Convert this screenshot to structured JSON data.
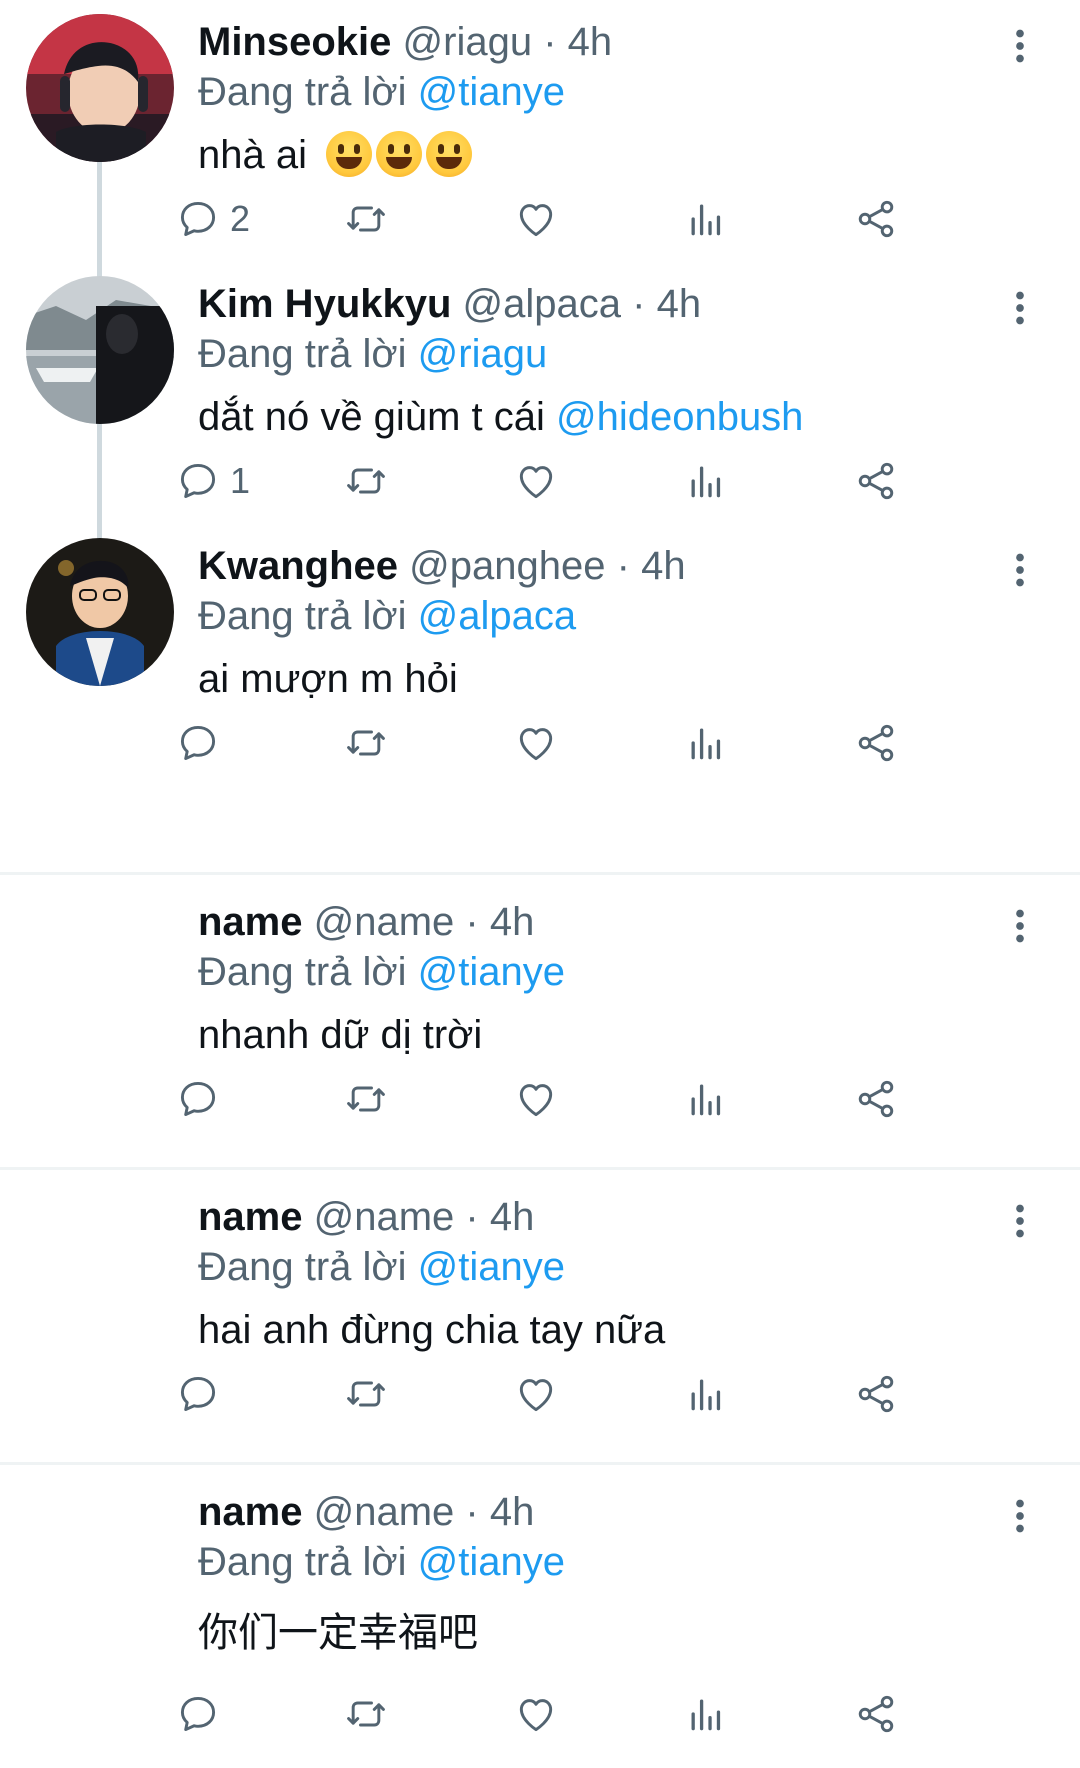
{
  "tweets": [
    {
      "name": "Minseokie",
      "handle": "@riagu",
      "time": "4h",
      "reply_prefix": "Đang trả lời",
      "reply_to": "@tianye",
      "text": "nhà ai",
      "emoji": "grinning-face x3",
      "reply_count": "2",
      "avatar": "photo"
    },
    {
      "name": "Kim Hyukkyu",
      "handle": "@alpaca",
      "time": "4h",
      "reply_prefix": "Đang trả lời",
      "reply_to": "@riagu",
      "text": "dắt nó về giùm t cái ",
      "mention": "@hideonbush",
      "reply_count": "1",
      "avatar": "photo"
    },
    {
      "name": "Kwanghee",
      "handle": "@panghee",
      "time": "4h",
      "reply_prefix": "Đang trả lời",
      "reply_to": "@alpaca",
      "text": "ai mượn m hỏi",
      "reply_count": "",
      "avatar": "photo"
    },
    {
      "name": "name",
      "handle": "@name",
      "time": "4h",
      "reply_prefix": "Đang trả lời",
      "reply_to": "@tianye",
      "text": "nhanh dữ dị trời",
      "reply_count": "",
      "avatar": "default-user"
    },
    {
      "name": "name",
      "handle": "@name",
      "time": "4h",
      "reply_prefix": "Đang trả lời",
      "reply_to": "@tianye",
      "text": "hai anh đừng chia tay nữa",
      "reply_count": "",
      "avatar": "default-user"
    },
    {
      "name": "name",
      "handle": "@name",
      "time": "4h",
      "reply_prefix": "Đang trả lời",
      "reply_to": "@tianye",
      "text": "你们一定幸福吧",
      "reply_count": "",
      "avatar": "default-user"
    }
  ],
  "dot_separator": "·",
  "colors": {
    "text": "#0f1419",
    "secondary": "#536471",
    "accent": "#1d9bf0",
    "thread_line": "#cfd9de",
    "divider": "#eff3f4"
  },
  "icons": [
    "reply-icon",
    "retweet-icon",
    "like-icon",
    "views-icon",
    "share-icon",
    "more-icon"
  ]
}
